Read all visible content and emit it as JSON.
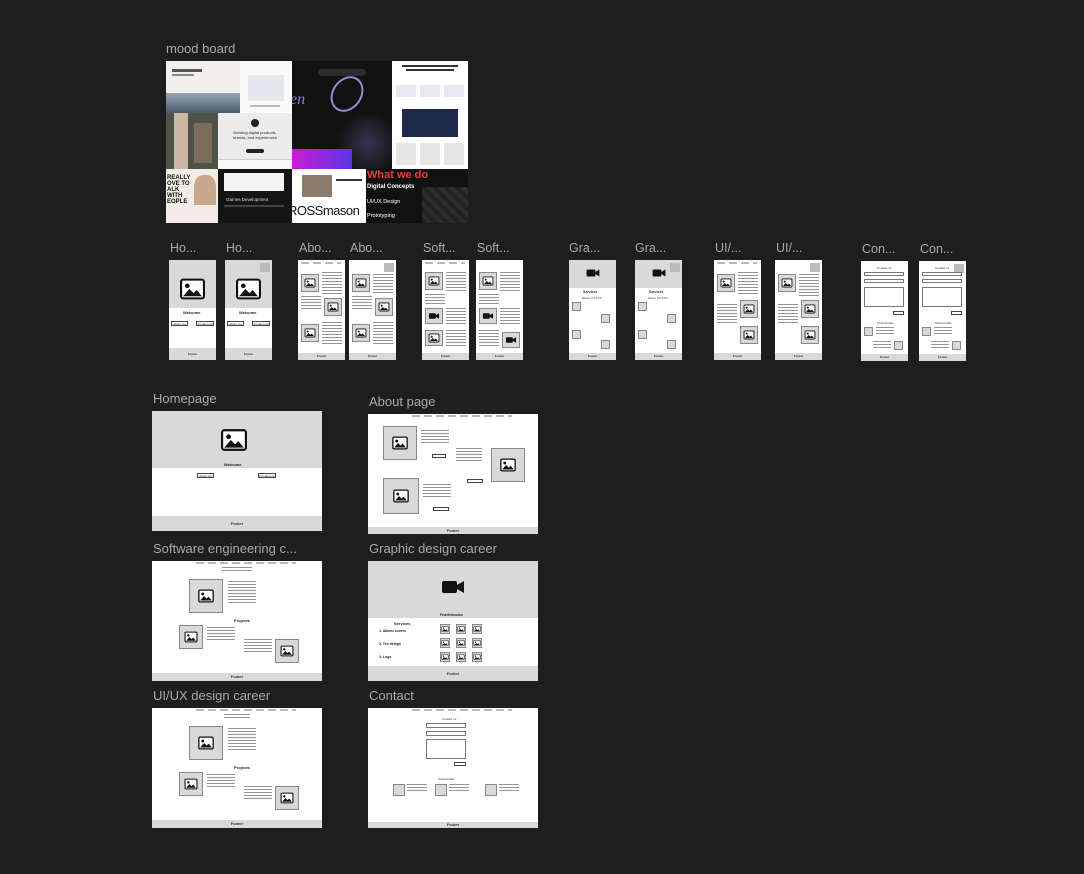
{
  "canvas": {
    "background": "#1e1e1e"
  },
  "mood_board": {
    "label": "mood board",
    "texts": {
      "building": "Building digital products, brands, and experiences",
      "what_we_do": "What we do",
      "digital_concepts": "Digital Concepts",
      "uiux": "UI/UX Design",
      "prototyping": "Prototyping",
      "really": "REALLY OVE TO ALK WITH EOPLE",
      "ross": "ROSSmason",
      "games": "Games Development",
      "script_word": "en"
    }
  },
  "mobile_frames": [
    {
      "label": "Ho...",
      "welcome": "Welcome",
      "btn1": "About me",
      "btn2": "Contact me",
      "footer": "Footer"
    },
    {
      "label": "Ho...",
      "welcome": "Welcome",
      "btn1": "About me",
      "btn2": "Contact me",
      "footer": "Footer"
    },
    {
      "label": "Abo...",
      "footer": "Footer"
    },
    {
      "label": "Abo...",
      "footer": "Footer"
    },
    {
      "label": "Soft...",
      "footer": "Footer"
    },
    {
      "label": "Soft...",
      "footer": "Footer"
    },
    {
      "label": "Gra...",
      "services": "Services",
      "name": "Name XX.XXX",
      "footer": "Footer"
    },
    {
      "label": "Gra...",
      "services": "Services",
      "name": "Name XX.XXX",
      "footer": "Footer"
    },
    {
      "label": "UI/...",
      "footer": "Footer"
    },
    {
      "label": "UI/...",
      "footer": "Footer"
    },
    {
      "label": "Con...",
      "contact": "Contact us",
      "testimonials": "Testimonials",
      "footer": "Footer"
    },
    {
      "label": "Con...",
      "contact": "Contact us",
      "testimonials": "Testimonials",
      "footer": "Footer"
    }
  ],
  "desktop_frames": {
    "homepage": {
      "label": "Homepage",
      "welcome": "Welcome",
      "btn1": "About me",
      "btn2": "Contact me",
      "footer": "Footer"
    },
    "about": {
      "label": "About page",
      "footer": "Footer"
    },
    "software": {
      "label": "Software engineering c...",
      "projects": "Projects",
      "footer": "Footer"
    },
    "graphic": {
      "label": "Graphic design career",
      "title": "Fedethbrooke",
      "services": "Services",
      "s1": "1. Album covers",
      "s2": "2. Tee design",
      "s3": "3. Logo",
      "footer": "Footer"
    },
    "uiux": {
      "label": "UI/UX design career",
      "projects": "Projects",
      "footer": "Footer"
    },
    "contact": {
      "label": "Contact",
      "contact": "Contact us",
      "testimonials": "Testimonials",
      "footer": "Footer"
    }
  }
}
